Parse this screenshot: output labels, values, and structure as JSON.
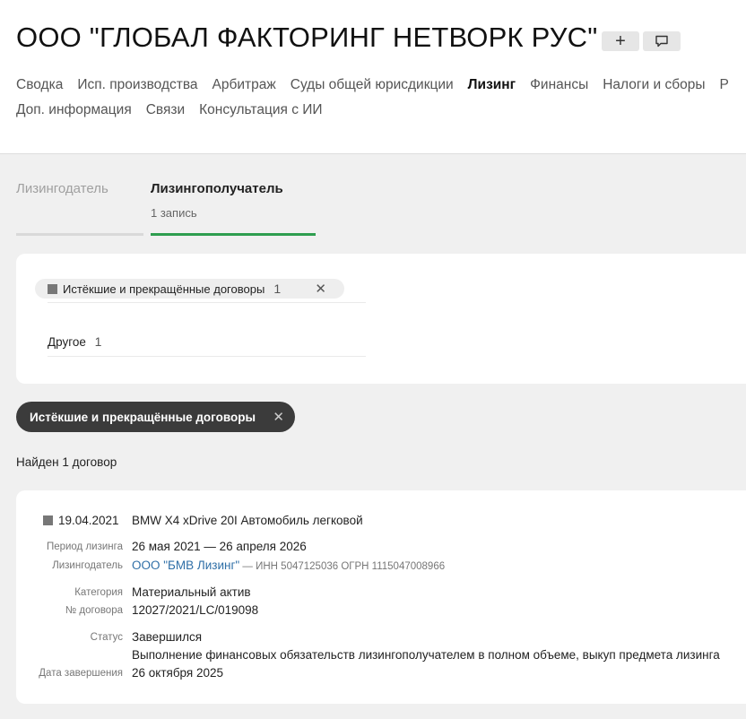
{
  "company": {
    "title": "ООО \"ГЛОБАЛ ФАКТОРИНГ НЕТВОРК РУС\"",
    "plus_icon": "plus-icon",
    "comment_icon": "comment-icon"
  },
  "nav": {
    "row1": [
      "Сводка",
      "Исп. производства",
      "Арбитраж",
      "Суды общей юрисдикции",
      "Лизинг",
      "Финансы",
      "Налоги и сборы",
      "Р"
    ],
    "row2": [
      "Доп. информация",
      "Связи",
      "Консультация с ИИ"
    ],
    "active": "Лизинг"
  },
  "tabs": {
    "lessor": {
      "label": "Лизингодатель"
    },
    "lessee": {
      "label": "Лизингополучатель",
      "sub": "1 запись"
    }
  },
  "filters": {
    "chip_label": "Истёкшие и прекращённые договоры",
    "chip_count": "1",
    "other_label": "Другое",
    "other_count": "1"
  },
  "active_filter": {
    "label": "Истёкшие и прекращённые договоры"
  },
  "found_text": "Найден 1 договор",
  "contract": {
    "date": "19.04.2021",
    "title": "BMW X4 xDrive 20I Автомобиль легковой",
    "period_label": "Период лизинга",
    "period_value": "26 мая 2021 — 26 апреля 2026",
    "lessor_label": "Лизингодатель",
    "lessor_name": "ООО \"БМВ Лизинг\"",
    "lessor_meta": " — ИНН 5047125036  ОГРН 1115047008966",
    "category_label": "Категория",
    "category_value": "Материальный актив",
    "number_label": "№ договора",
    "number_value": "12027/2021/LC/019098",
    "status_label": "Статус",
    "status_value": "Завершился",
    "status_note": "Выполнение финансовых обязательств лизингополучателем в полном объеме, выкуп предмета лизинга",
    "end_label": "Дата завершения",
    "end_value": "26 октября 2025"
  },
  "colors": {
    "accent_green": "#2e9e4f",
    "link_blue": "#2f6fa7",
    "dark_chip": "#3b3b3b"
  }
}
